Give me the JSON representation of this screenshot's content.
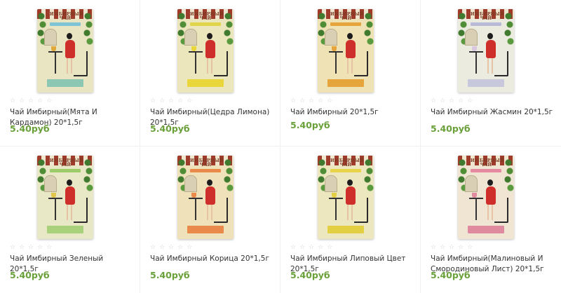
{
  "brand_text": "ИМБИРНЫЙ ЧАЙ",
  "colors": {
    "price_green": "#6aa03a",
    "star_gray": "#d0d0d0",
    "name_text": "#333333"
  },
  "products": [
    {
      "name": "Чай Имбирный(Мята И Кардамон) 20*1,5г",
      "price": "5.40руб",
      "rating_stars": 0,
      "box_bg": "#e9e4c1",
      "label_color": "#7ec4d6",
      "bottom_label_color": "#8cc7b4",
      "cup_color": "#e0a93c",
      "stars": "☆☆☆☆☆"
    },
    {
      "name": "Чай Имбирный(Цедра Лимона) 20*1,5г",
      "price": "5.40руб",
      "rating_stars": 0,
      "box_bg": "#ece6bd",
      "label_color": "#e2d44a",
      "bottom_label_color": "#e9d63a",
      "cup_color": "#e9d63a",
      "stars": "☆☆☆☆☆"
    },
    {
      "name": "Чай Имбирный 20*1,5г",
      "price": "5.40руб",
      "rating_stars": 0,
      "box_bg": "#efe3b6",
      "label_color": "#e6a43c",
      "bottom_label_color": "#e6a43c",
      "cup_color": "#e6a43c",
      "stars": "☆☆☆☆☆"
    },
    {
      "name": "Чай Имбирный Жасмин 20*1,5г",
      "price": "5.40руб",
      "rating_stars": 0,
      "box_bg": "#ecebdf",
      "label_color": "#b9b9d8",
      "bottom_label_color": "#c8c8dc",
      "cup_color": "#d8c7de",
      "stars": "☆☆☆☆☆"
    },
    {
      "name": "Чай Имбирный Зеленый 20*1,5г",
      "price": "5.40руб",
      "rating_stars": 0,
      "box_bg": "#e9e8c6",
      "label_color": "#9ccc6a",
      "bottom_label_color": "#a9d07a",
      "cup_color": "#e0c64a",
      "stars": "☆☆☆☆☆"
    },
    {
      "name": "Чай Имбирный Корица 20*1,5г",
      "price": "5.40руб",
      "rating_stars": 0,
      "box_bg": "#efe1b9",
      "label_color": "#e98a4a",
      "bottom_label_color": "#e98a4a",
      "cup_color": "#e98a4a",
      "stars": "☆☆☆☆☆"
    },
    {
      "name": "Чай Имбирный Липовый Цвет 20*1,5г",
      "price": "5.40руб",
      "rating_stars": 0,
      "box_bg": "#ece7bf",
      "label_color": "#e8d44a",
      "bottom_label_color": "#e2cf44",
      "cup_color": "#e2cf44",
      "stars": "☆☆☆☆☆"
    },
    {
      "name": "Чай Имбирный(Малиновый И Смородиновый Лист) 20*1,5г",
      "price": "5.40руб",
      "rating_stars": 0,
      "box_bg": "#efe5d2",
      "label_color": "#e58aa0",
      "bottom_label_color": "#e08aa0",
      "cup_color": "#e08aa0",
      "stars": "☆☆☆☆☆"
    }
  ]
}
